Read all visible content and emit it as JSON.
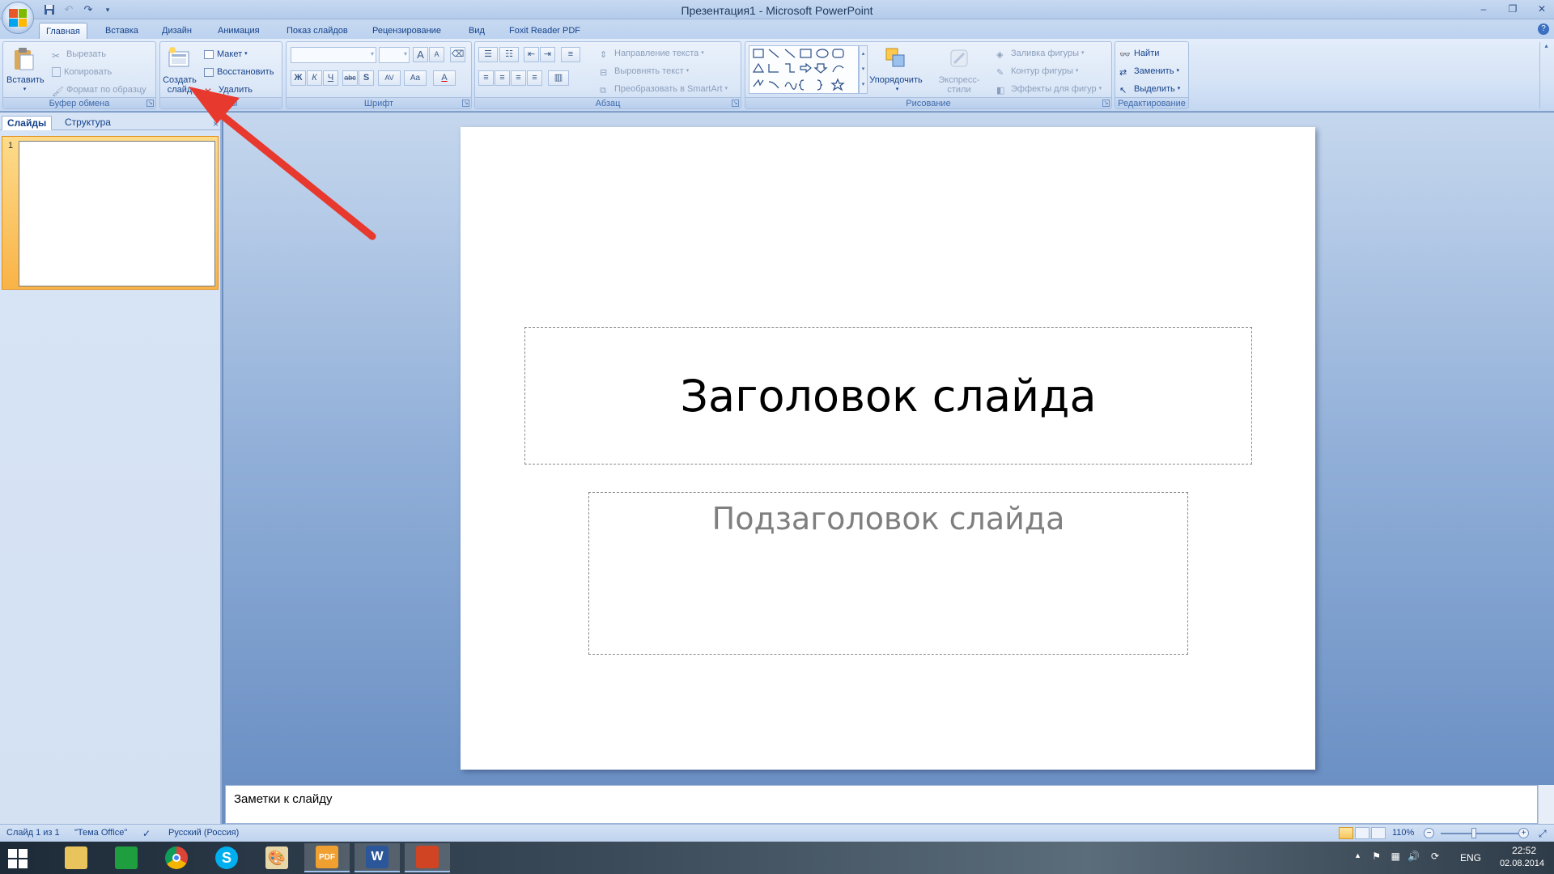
{
  "window": {
    "title": "Презентация1 - Microsoft PowerPoint"
  },
  "tabs": [
    "Главная",
    "Вставка",
    "Дизайн",
    "Анимация",
    "Показ слайдов",
    "Рецензирование",
    "Вид",
    "Foxit Reader PDF"
  ],
  "ribbon": {
    "clipboard": {
      "label": "Буфер обмена",
      "paste": "Вставить",
      "cut": "Вырезать",
      "copy": "Копировать",
      "format_painter": "Формат по образцу"
    },
    "slides": {
      "label": "Слайды",
      "new_slide_line1": "Создать",
      "new_slide_line2": "слайд",
      "layout": "Макет",
      "reset": "Восстановить",
      "delete": "Удалить"
    },
    "font": {
      "label": "Шрифт",
      "bold": "Ж",
      "italic": "К",
      "underline": "Ч",
      "strike": "abc",
      "shadow": "S",
      "spacing": "AV",
      "case": "Aa",
      "color": "A",
      "grow": "A",
      "shrink": "A"
    },
    "paragraph": {
      "label": "Абзац",
      "text_direction": "Направление текста",
      "align_text": "Выровнять текст",
      "smartart": "Преобразовать в SmartArt"
    },
    "drawing": {
      "label": "Рисование",
      "arrange": "Упорядочить",
      "quick_styles": "Экспресс-стили",
      "fill": "Заливка фигуры",
      "outline": "Контур фигуры",
      "effects": "Эффекты для фигур"
    },
    "editing": {
      "label": "Редактирование",
      "find": "Найти",
      "replace": "Заменить",
      "select": "Выделить"
    }
  },
  "left_pane": {
    "tab_slides": "Слайды",
    "tab_outline": "Структура",
    "close": "×",
    "thumb_number": "1"
  },
  "slide": {
    "title": "Заголовок слайда",
    "subtitle": "Подзаголовок слайда"
  },
  "notes": {
    "placeholder": "Заметки к слайду"
  },
  "status": {
    "slide_info": "Слайд 1 из 1",
    "theme": "\"Тема Office\"",
    "language": "Русский (Россия)",
    "zoom": "110%"
  },
  "taskbar": {
    "language": "ENG",
    "time": "22:52",
    "date": "02.08.2014",
    "apps": [
      "file-explorer",
      "store",
      "chrome",
      "skype",
      "paint",
      "foxit-pdf",
      "word",
      "powerpoint"
    ],
    "pdf_label": "PDF",
    "word_label": "W",
    "skype_label": "S"
  },
  "colors": {
    "arrow": "#e8392e",
    "ribbon_text": "#15428b",
    "selection": "#f9b347"
  }
}
